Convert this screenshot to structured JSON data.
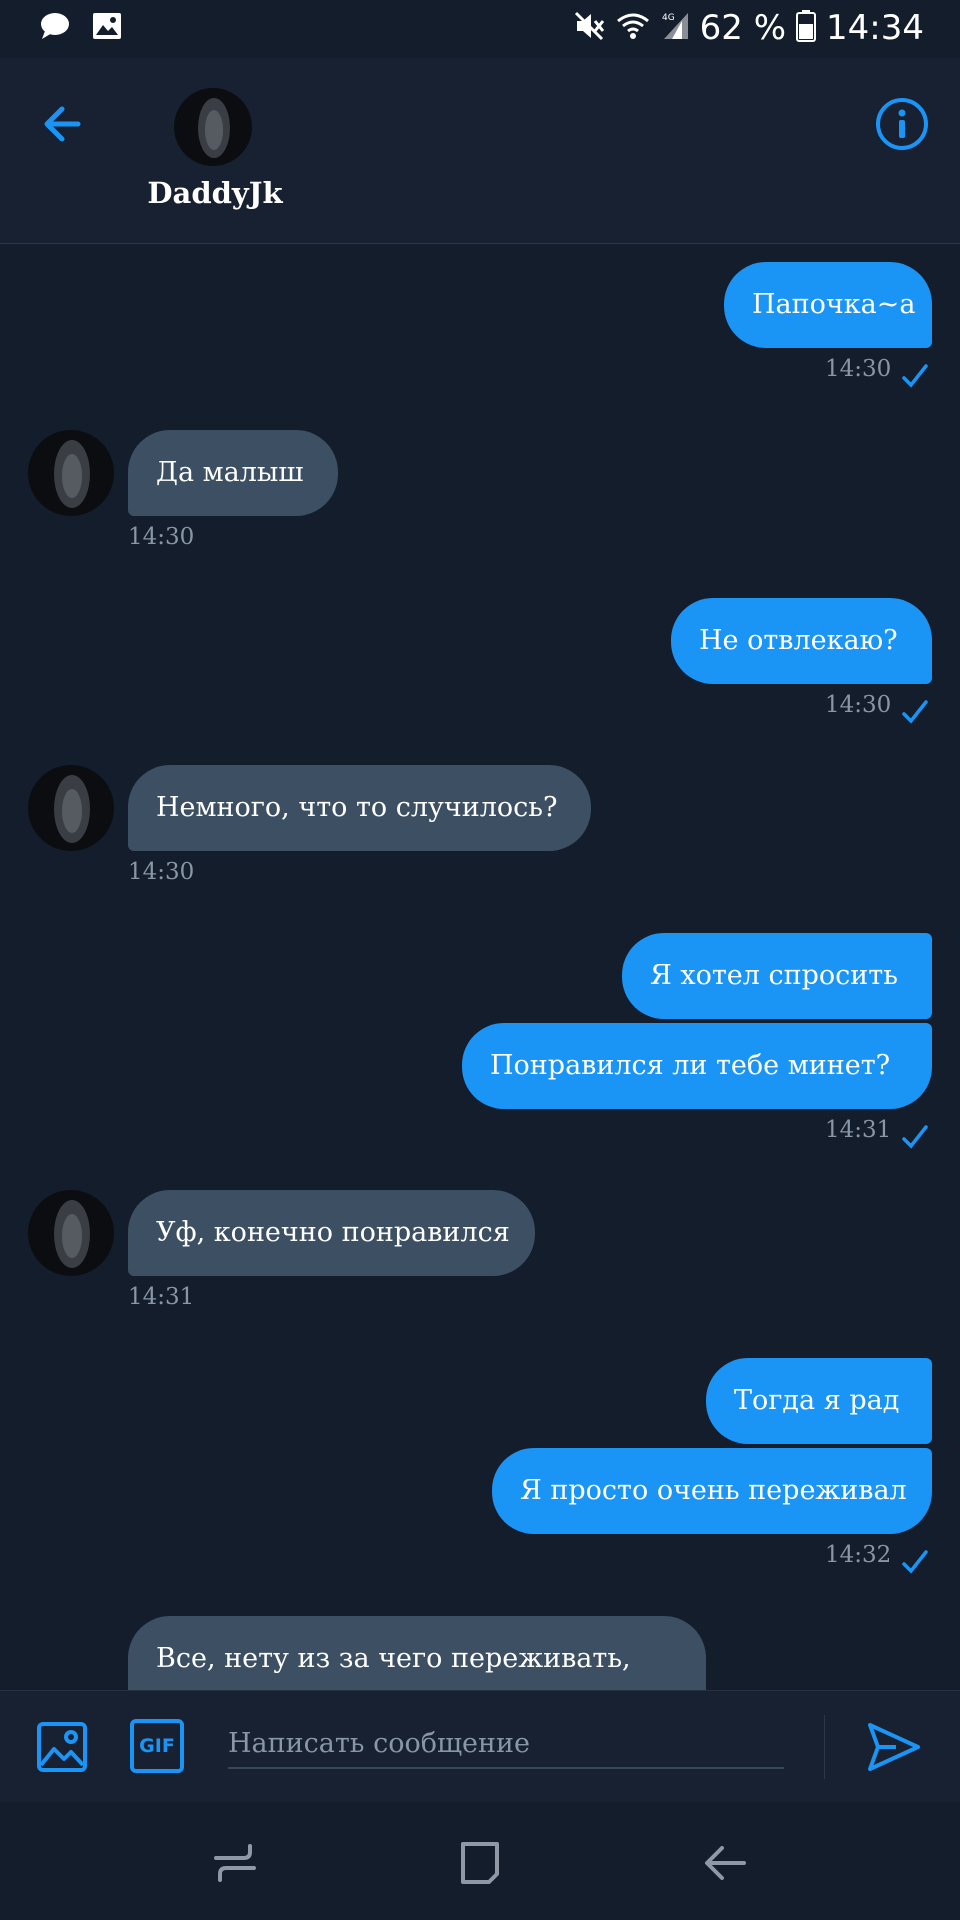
{
  "status_bar": {
    "battery": "62 %",
    "time": "14:34"
  },
  "header": {
    "contact_name": "DaddyJk"
  },
  "messages": [
    {
      "text": "Папочка~a",
      "time": "14:30"
    },
    {
      "text": "Да малыш",
      "time": "14:30"
    },
    {
      "text": "Не отвлекаю?",
      "time": "14:30"
    },
    {
      "text": "Немного, что то случилось?",
      "time": "14:30"
    },
    {
      "text": "Я хотел спросить"
    },
    {
      "text": "Понравился ли тебе минет?",
      "time": "14:31"
    },
    {
      "text": "Уф, конечно понравился",
      "time": "14:31"
    },
    {
      "text": "Тогда я рад"
    },
    {
      "text": "Я просто очень переживал",
      "time": "14:32"
    },
    {
      "text": "Все, нету из за чего переживать,"
    }
  ],
  "composer": {
    "gif_label": "GIF",
    "placeholder": "Написать сообщение"
  },
  "colors": {
    "accent": "#1b95f5",
    "background": "#141d2b",
    "incoming_bubble": "#3d4f63",
    "timestamp": "#8896a7"
  },
  "icons": [
    "chat-icon",
    "image-icon",
    "mute-icon",
    "wifi-icon",
    "signal-icon",
    "battery-icon",
    "back-arrow-icon",
    "info-icon",
    "read-check-icon",
    "image-attach-icon",
    "send-icon",
    "recents-icon",
    "home-icon",
    "nav-back-icon"
  ]
}
